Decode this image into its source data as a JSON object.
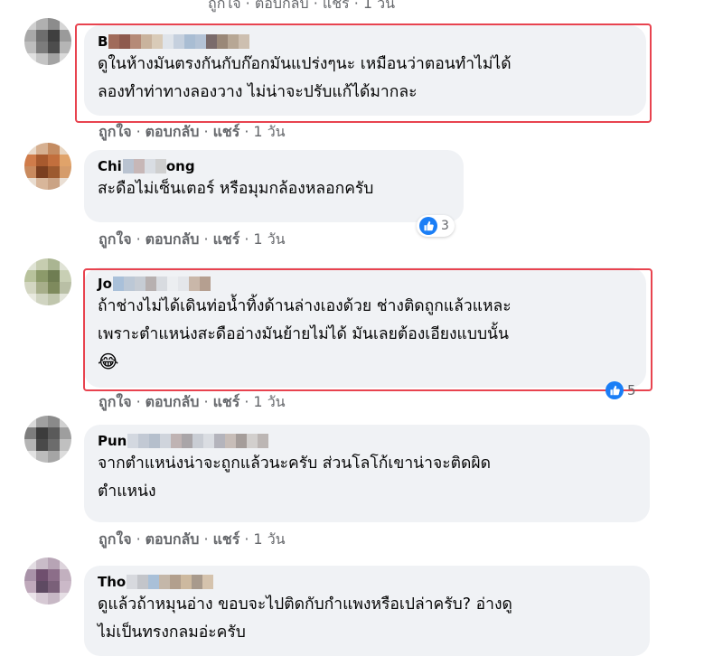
{
  "actions": {
    "like": "ถูกใจ",
    "reply": "ตอบกลับ",
    "share": "แชร์",
    "sep": "·"
  },
  "top_actions": "ถูกใจ · ตอบกลับ · แชร์ · 1 วัน",
  "comments": [
    {
      "name_visible": "B",
      "lines": [
        "ดูในห้างมันตรงกันกับก๊อกมันแปร่งๆนะ เหมือนว่าตอนทำไม่ได้",
        "ลองทำท่าทางลองวาง ไม่น่าจะปรับแก้ได้มากละ"
      ],
      "time": "1 วัน",
      "reactions": null,
      "highlighted": true
    },
    {
      "name_visible": "Chi",
      "name_tail": "ong",
      "lines": [
        "สะดือไม่เซ็นเตอร์ หรือมุมกล้องหลอกครับ"
      ],
      "time": "1 วัน",
      "reactions": {
        "icon": "like-icon",
        "count": "3"
      },
      "highlighted": false
    },
    {
      "name_visible": "Jo",
      "lines": [
        "ถ้าช่างไม่ได้เดินท่อน้ำทิ้งด้านล่างเองด้วย ช่างติดถูกแล้วแหละ",
        "เพราะตำแหน่งสะดืออ่างมันย้ายไม่ได้ มันเลยต้องเอียงแบบนั้น"
      ],
      "emoji": "😂",
      "time": "1 วัน",
      "reactions": {
        "icon": "like-icon",
        "count": "5"
      },
      "highlighted": true
    },
    {
      "name_visible": "Pun",
      "lines": [
        "จากตำแหน่งน่าจะถูกแล้วนะครับ ส่วนโลโก้เขาน่าจะติดผิด",
        "ตำแหน่ง"
      ],
      "time": "1 วัน",
      "reactions": null,
      "highlighted": false
    },
    {
      "name_visible": "Tho",
      "lines": [
        "ดูแล้วถ้าหมุนอ่าง ขอบจะไปติดกับกำแพงหรือเปล่าครับ? อ่างดู",
        "ไม่เป็นทรงกลมอ่ะครับ"
      ],
      "time": "",
      "reactions": null,
      "highlighted": false
    }
  ],
  "colors": {
    "bubble": "#f0f2f5",
    "meta_text": "#65676b",
    "highlight": "#e8434f",
    "like_blue": "#1a7ef6"
  }
}
